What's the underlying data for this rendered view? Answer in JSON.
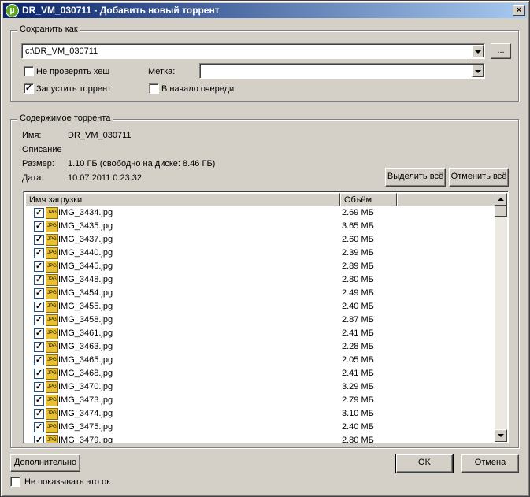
{
  "window": {
    "title": "DR_VM_030711 - Добавить новый торрент",
    "icon": "utorrent-logo-icon",
    "close_label": "×"
  },
  "save_as": {
    "group_label": "Сохранить как",
    "path_value": "c:\\DR_VM_030711",
    "browse_label": "...",
    "skip_hash_label": "Не проверять хеш",
    "skip_hash_checked": false,
    "start_label": "Запустить торрент",
    "start_checked": true,
    "label_caption": "Метка:",
    "label_value": "",
    "top_queue_label": "В начало очереди",
    "top_queue_checked": false
  },
  "contents": {
    "group_label": "Содержимое торрента",
    "name_caption": "Имя:",
    "name_value": "DR_VM_030711",
    "description_caption": "Описание",
    "size_caption": "Размер:",
    "size_value": "1.10 ГБ (свободно на диске: 8.46 ГБ)",
    "date_caption": "Дата:",
    "date_value": "10.07.2011 0:23:32",
    "select_all_label": "Выделить всё",
    "deselect_all_label": "Отменить всё",
    "columns": [
      "Имя загрузки",
      "Объём"
    ],
    "files": [
      {
        "name": "IMG_3434.jpg",
        "size": "2.69 МБ"
      },
      {
        "name": "IMG_3435.jpg",
        "size": "3.65 МБ"
      },
      {
        "name": "IMG_3437.jpg",
        "size": "2.60 МБ"
      },
      {
        "name": "IMG_3440.jpg",
        "size": "2.39 МБ"
      },
      {
        "name": "IMG_3445.jpg",
        "size": "2.89 МБ"
      },
      {
        "name": "IMG_3448.jpg",
        "size": "2.80 МБ"
      },
      {
        "name": "IMG_3454.jpg",
        "size": "2.49 МБ"
      },
      {
        "name": "IMG_3455.jpg",
        "size": "2.40 МБ"
      },
      {
        "name": "IMG_3458.jpg",
        "size": "2.87 МБ"
      },
      {
        "name": "IMG_3461.jpg",
        "size": "2.41 МБ"
      },
      {
        "name": "IMG_3463.jpg",
        "size": "2.28 МБ"
      },
      {
        "name": "IMG_3465.jpg",
        "size": "2.05 МБ"
      },
      {
        "name": "IMG_3468.jpg",
        "size": "2.41 МБ"
      },
      {
        "name": "IMG_3470.jpg",
        "size": "3.29 МБ"
      },
      {
        "name": "IMG_3473.jpg",
        "size": "2.79 МБ"
      },
      {
        "name": "IMG_3474.jpg",
        "size": "3.10 МБ"
      },
      {
        "name": "IMG_3475.jpg",
        "size": "2.40 МБ"
      },
      {
        "name": "IMG_3479.jpg",
        "size": "2.80 МБ"
      }
    ]
  },
  "footer": {
    "advanced_label": "Дополнительно",
    "ok_label": "OK",
    "cancel_label": "Отмена",
    "dont_show_label": "Не показывать это ок",
    "dont_show_checked": false
  }
}
